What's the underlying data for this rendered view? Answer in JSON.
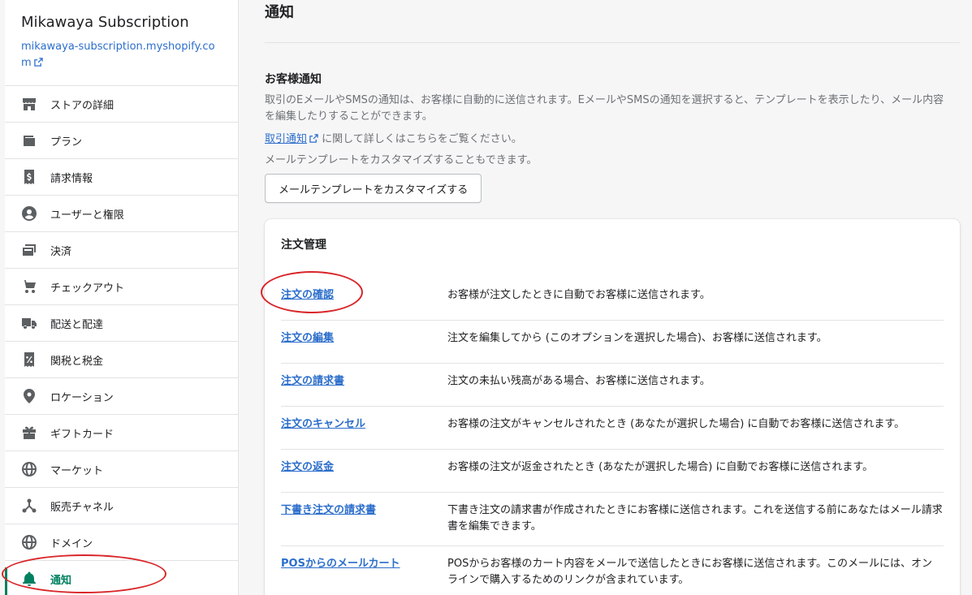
{
  "sidebar": {
    "store_name": "Mikawaya Subscription",
    "store_url": "mikawaya-subscription.myshopify.com",
    "items": [
      {
        "label": "ストアの詳細",
        "icon": "store-icon"
      },
      {
        "label": "プラン",
        "icon": "wallet-icon"
      },
      {
        "label": "請求情報",
        "icon": "receipt-dollar-icon"
      },
      {
        "label": "ユーザーと権限",
        "icon": "user-circle-icon"
      },
      {
        "label": "決済",
        "icon": "payment-card-icon"
      },
      {
        "label": "チェックアウト",
        "icon": "cart-icon"
      },
      {
        "label": "配送と配達",
        "icon": "truck-icon"
      },
      {
        "label": "関税と税金",
        "icon": "receipt-percent-icon"
      },
      {
        "label": "ロケーション",
        "icon": "location-pin-icon"
      },
      {
        "label": "ギフトカード",
        "icon": "gift-icon"
      },
      {
        "label": "マーケット",
        "icon": "globe-icon"
      },
      {
        "label": "販売チャネル",
        "icon": "channels-icon"
      },
      {
        "label": "ドメイン",
        "icon": "domain-globe-icon"
      },
      {
        "label": "通知",
        "icon": "bell-icon",
        "active": true
      }
    ]
  },
  "main": {
    "title": "通知",
    "customer_section": {
      "title": "お客様通知",
      "description": "取引のEメールやSMSの通知は、お客様に自動的に送信されます。EメールやSMSの通知を選択すると、テンプレートを表示したり、メール内容を編集したりすることができます。",
      "link_text": "取引通知",
      "link_suffix": " に関して詳しくはこちらをご覧ください。",
      "customize_text": "メールテンプレートをカスタマイズすることもできます。",
      "button_label": "メールテンプレートをカスタマイズする"
    },
    "order_card": {
      "title": "注文管理",
      "rows": [
        {
          "name": "注文の確認",
          "desc": "お客様が注文したときに自動でお客様に送信されます。"
        },
        {
          "name": "注文の編集",
          "desc": "注文を編集してから (このオプションを選択した場合)、お客様に送信されます。"
        },
        {
          "name": "注文の請求書",
          "desc": "注文の未払い残高がある場合、お客様に送信されます。"
        },
        {
          "name": "注文のキャンセル",
          "desc": "お客様の注文がキャンセルされたとき (あなたが選択した場合) に自動でお客様に送信されます。"
        },
        {
          "name": "注文の返金",
          "desc": "お客様の注文が返金されたとき (あなたが選択した場合) に自動でお客様に送信されます。"
        },
        {
          "name": "下書き注文の請求書",
          "desc": "下書き注文の請求書が作成されたときにお客様に送信されます。これを送信する前にあなたはメール請求書を編集できます。"
        },
        {
          "name": "POSからのメールカート",
          "desc": "POSからお客様のカート内容をメールで送信したときにお客様に送信されます。このメールには、オンラインで購入するためのリンクが含まれています。"
        }
      ]
    }
  },
  "colors": {
    "accent": "#008060",
    "link": "#2c6ecb",
    "annotation": "#d9262a"
  }
}
